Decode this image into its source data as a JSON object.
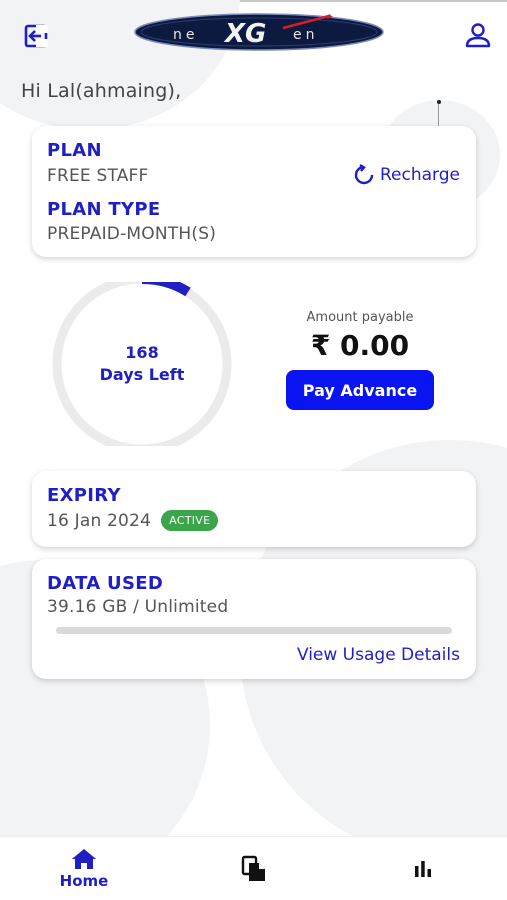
{
  "header": {
    "logo_text": "neXGen",
    "back_icon": "logout-icon",
    "profile_icon": "user-icon"
  },
  "greeting": "Hi Lal(ahmaing),",
  "plan": {
    "plan_label": "PLAN",
    "plan_value": "FREE STAFF",
    "type_label": "PLAN TYPE",
    "type_value": "PREPAID-MONTH(S)",
    "recharge_label": "Recharge",
    "recharge_icon": "refresh-icon"
  },
  "days": {
    "count": "168",
    "label": "Days Left"
  },
  "payment": {
    "amount_label": "Amount payable",
    "amount_value": "₹ 0.00",
    "pay_button": "Pay Advance"
  },
  "expiry": {
    "label": "EXPIRY",
    "date": "16 Jan 2024",
    "status": "ACTIVE"
  },
  "data_used": {
    "label": "DATA USED",
    "value": "39.16 GB / Unlimited",
    "view_link": "View Usage Details"
  },
  "nav": {
    "home_label": "Home",
    "home_icon": "home-icon",
    "docs_icon": "documents-icon",
    "stats_icon": "bar-chart-icon"
  },
  "colors": {
    "accent": "#1f1fc4",
    "button": "#0a14f0",
    "badge": "#3aa54a"
  }
}
